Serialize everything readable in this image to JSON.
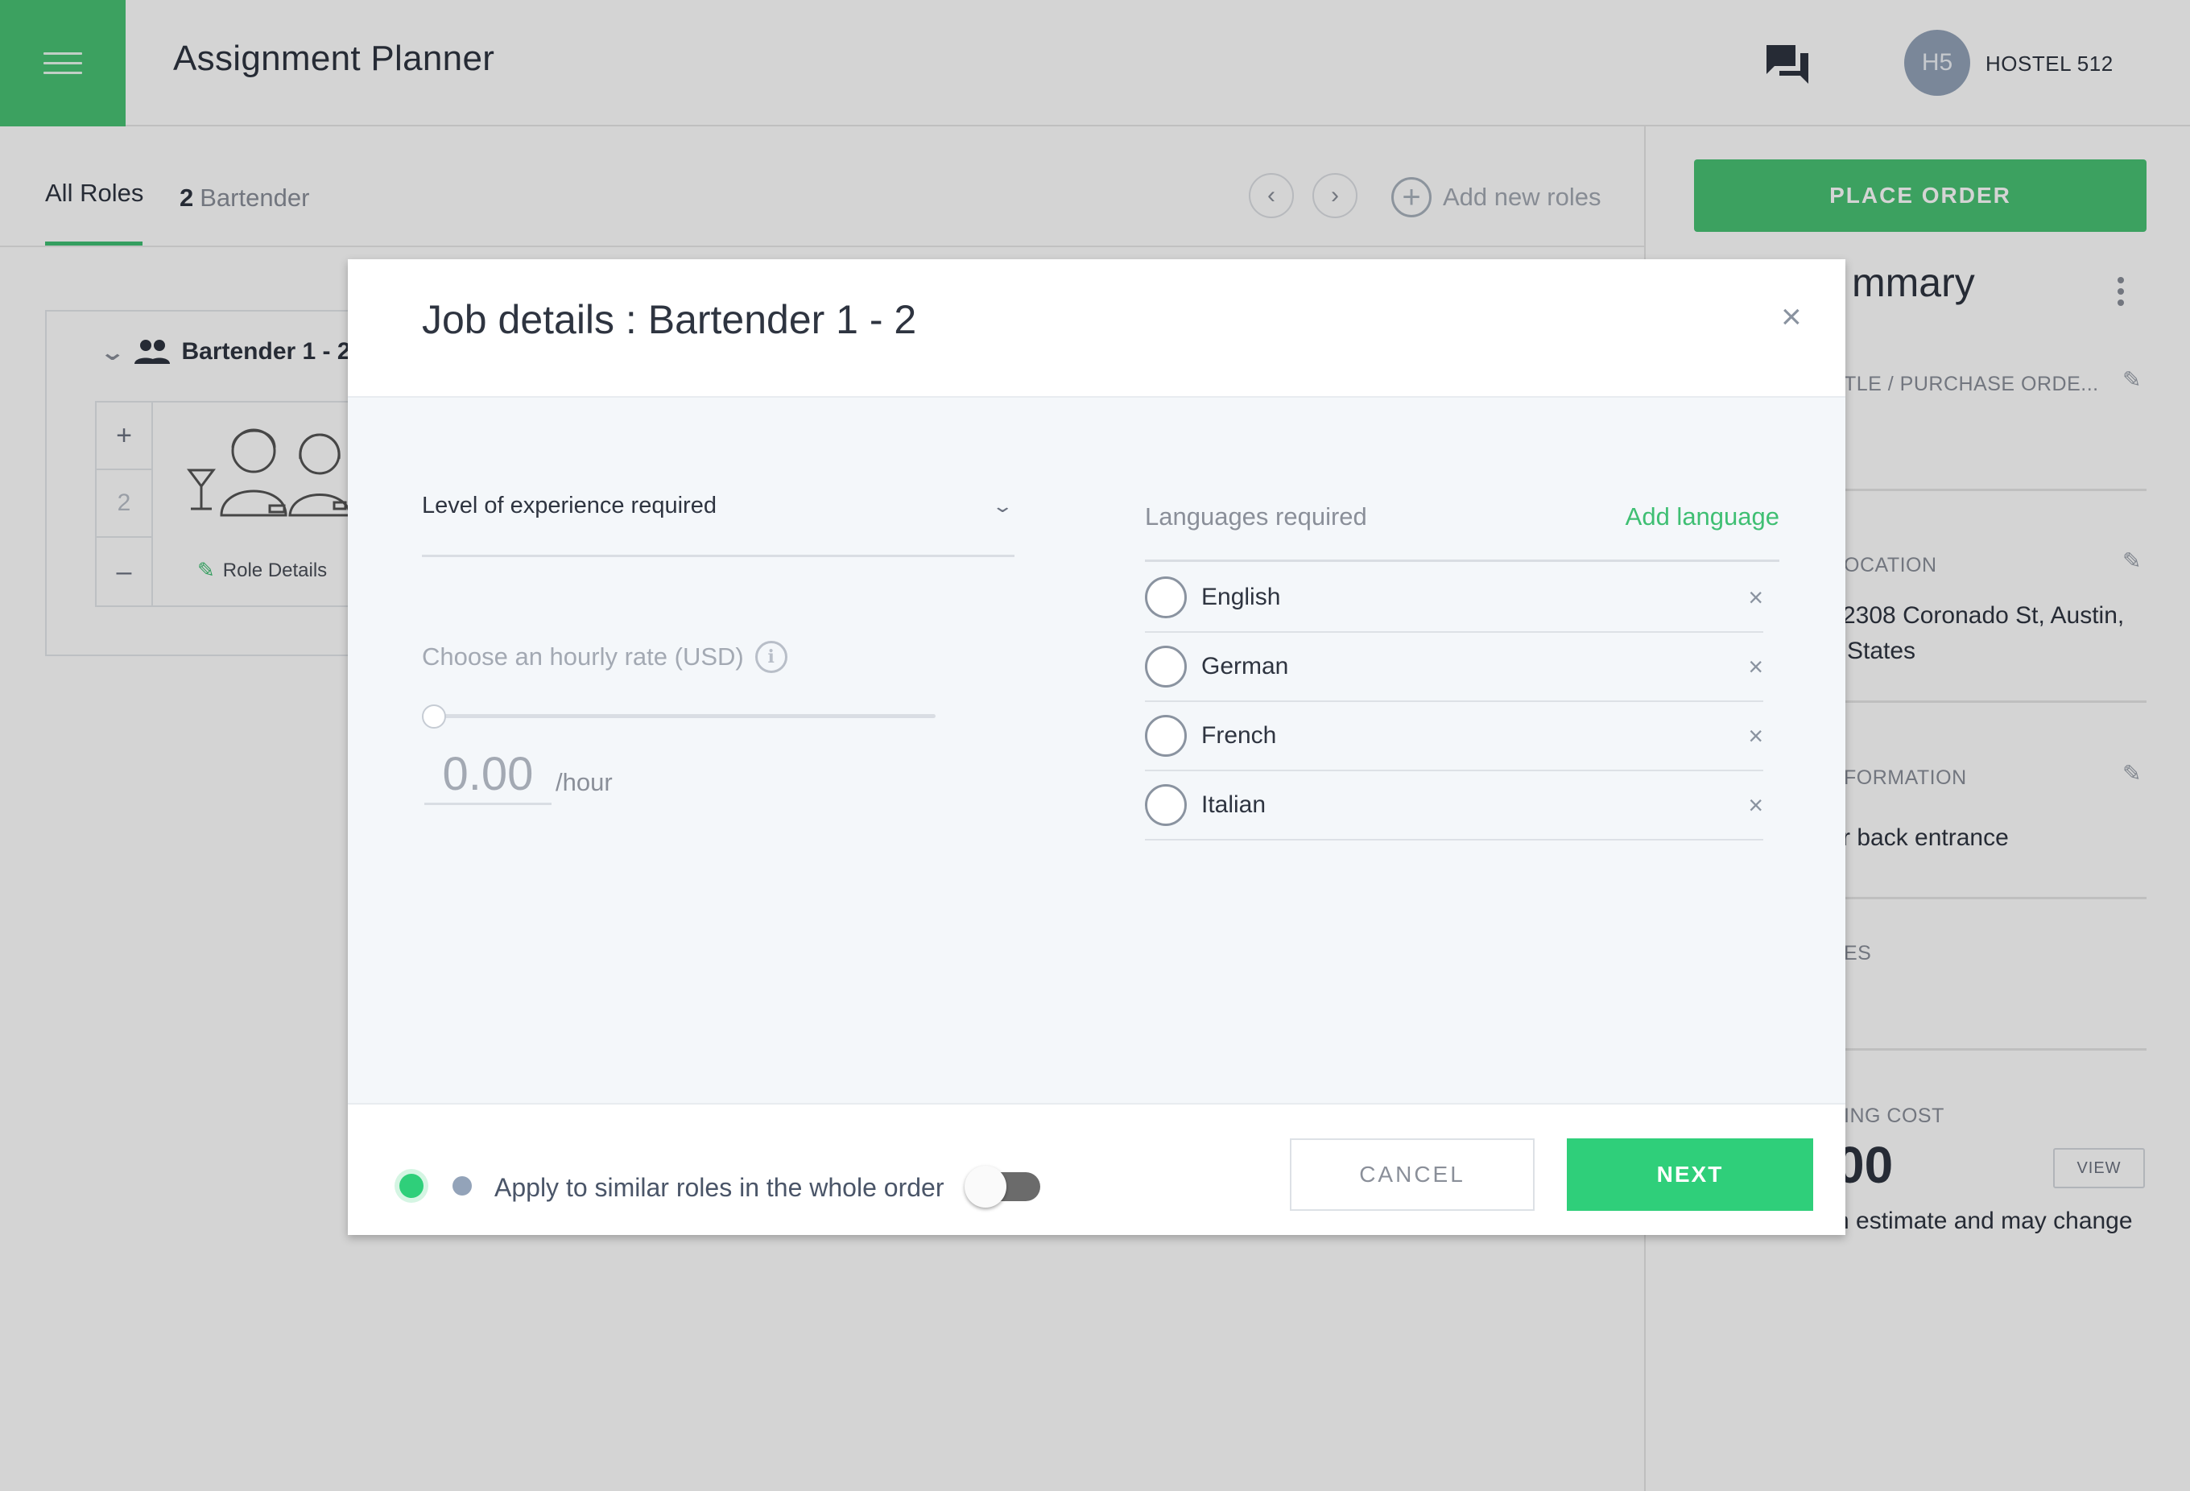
{
  "header": {
    "app_title": "Assignment Planner",
    "avatar_initials": "H5",
    "user_name": "HOSTEL 512"
  },
  "tabs": {
    "all_roles": "All Roles",
    "role_count": "2",
    "role_name": "Bartender",
    "add_roles": "Add new roles"
  },
  "role_card": {
    "title": "Bartender 1 - 2",
    "quantity": "2",
    "plus": "+",
    "minus": "–",
    "details_label": "Role Details"
  },
  "summary": {
    "place_order": "PLACE ORDER",
    "title_partial": "mmary",
    "title_po_partial": "TLE / PURCHASE ORDE...",
    "location_label_partial": "OCATION",
    "location_line1_partial": "2308 Coronado St, Austin,",
    "location_line2_partial": "States",
    "info_label_partial": "FORMATION",
    "info_text_partial": "r back entrance",
    "notes_label_partial": "ES",
    "cost_label_partial": "ING COST",
    "cost_value_partial": "00",
    "view_button": "VIEW",
    "estimate_partial": "n estimate and may change"
  },
  "modal": {
    "title": "Job details : Bartender 1 - 2",
    "close": "×",
    "experience_label": "Level of experience required",
    "rate_label": "Choose an hourly rate (USD)",
    "info_glyph": "i",
    "rate_value": "0.00",
    "rate_unit": "/hour",
    "rate_fraction": 0,
    "languages_label": "Languages required",
    "add_language": "Add language",
    "languages": [
      "English",
      "German",
      "French",
      "Italian"
    ],
    "apply_label": "Apply to similar roles in the whole order",
    "apply_toggle_on": false,
    "cancel": "CANCEL",
    "next": "NEXT"
  },
  "colors": {
    "brand_green": "#49c274",
    "next_green": "#2fcf7a",
    "link_green": "#3fbf73",
    "avatar_grey": "#93a3b9"
  }
}
